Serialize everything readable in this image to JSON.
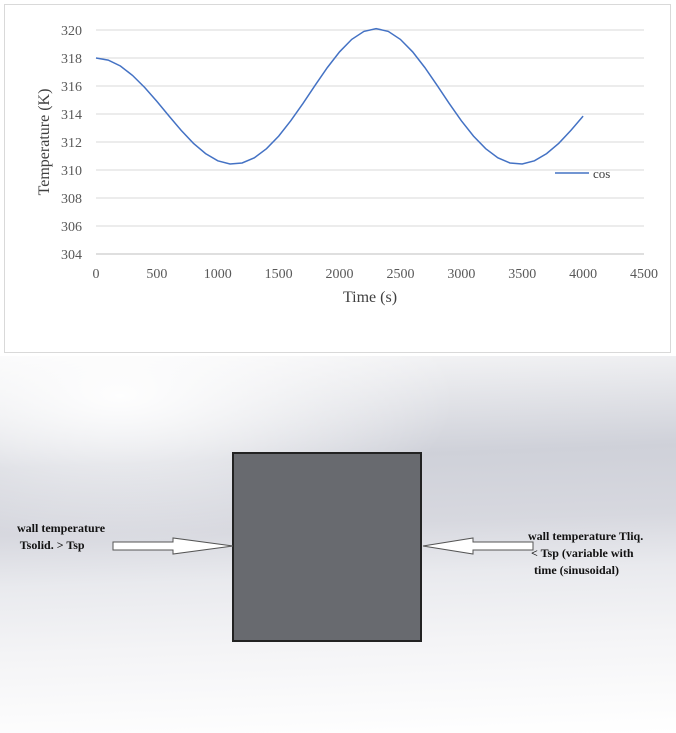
{
  "chart_data": {
    "type": "line",
    "xlabel": "Time (s)",
    "ylabel": "Temperature (K)",
    "xlim": [
      0,
      4500
    ],
    "ylim": [
      304,
      320
    ],
    "x_ticks": [
      "0",
      "500",
      "1000",
      "1500",
      "2000",
      "2500",
      "3000",
      "3500",
      "4000",
      "4500"
    ],
    "y_ticks": [
      "304",
      "306",
      "308",
      "310",
      "312",
      "314",
      "316",
      "318",
      "320"
    ],
    "grid": "horizontal",
    "legend_position": "right",
    "series": [
      {
        "name": "cos",
        "color": "#4472c4",
        "x": [
          0,
          100,
          200,
          300,
          400,
          500,
          600,
          700,
          800,
          900,
          1000,
          1100,
          1200,
          1300,
          1400,
          1500,
          1600,
          1700,
          1800,
          1900,
          2000,
          2100,
          2200,
          2300,
          2400,
          2500,
          2600,
          2700,
          2800,
          2900,
          3000,
          3100,
          3200,
          3300,
          3400,
          3500,
          3600,
          3700,
          3800,
          3900,
          4000
        ],
        "y": [
          318.0,
          317.85,
          317.43,
          316.76,
          315.89,
          314.9,
          313.85,
          312.83,
          311.91,
          311.17,
          310.66,
          310.43,
          310.5,
          310.87,
          311.52,
          312.42,
          313.52,
          314.76,
          316.06,
          317.32,
          318.44,
          319.33,
          319.9,
          320.1,
          319.9,
          319.33,
          318.44,
          317.32,
          316.06,
          314.76,
          313.52,
          312.42,
          311.52,
          310.87,
          310.5,
          310.43,
          310.66,
          311.17,
          311.91,
          312.83,
          313.85
        ]
      }
    ]
  },
  "diagram": {
    "left_label": "wall temperature\n Tsolid. > Tsp",
    "right_label": "wall temperature Tliq.\n < Tsp (variable with\n  time (sinusoidal)",
    "block_color": "#686a6f",
    "arrow_color": "#ffffff"
  }
}
